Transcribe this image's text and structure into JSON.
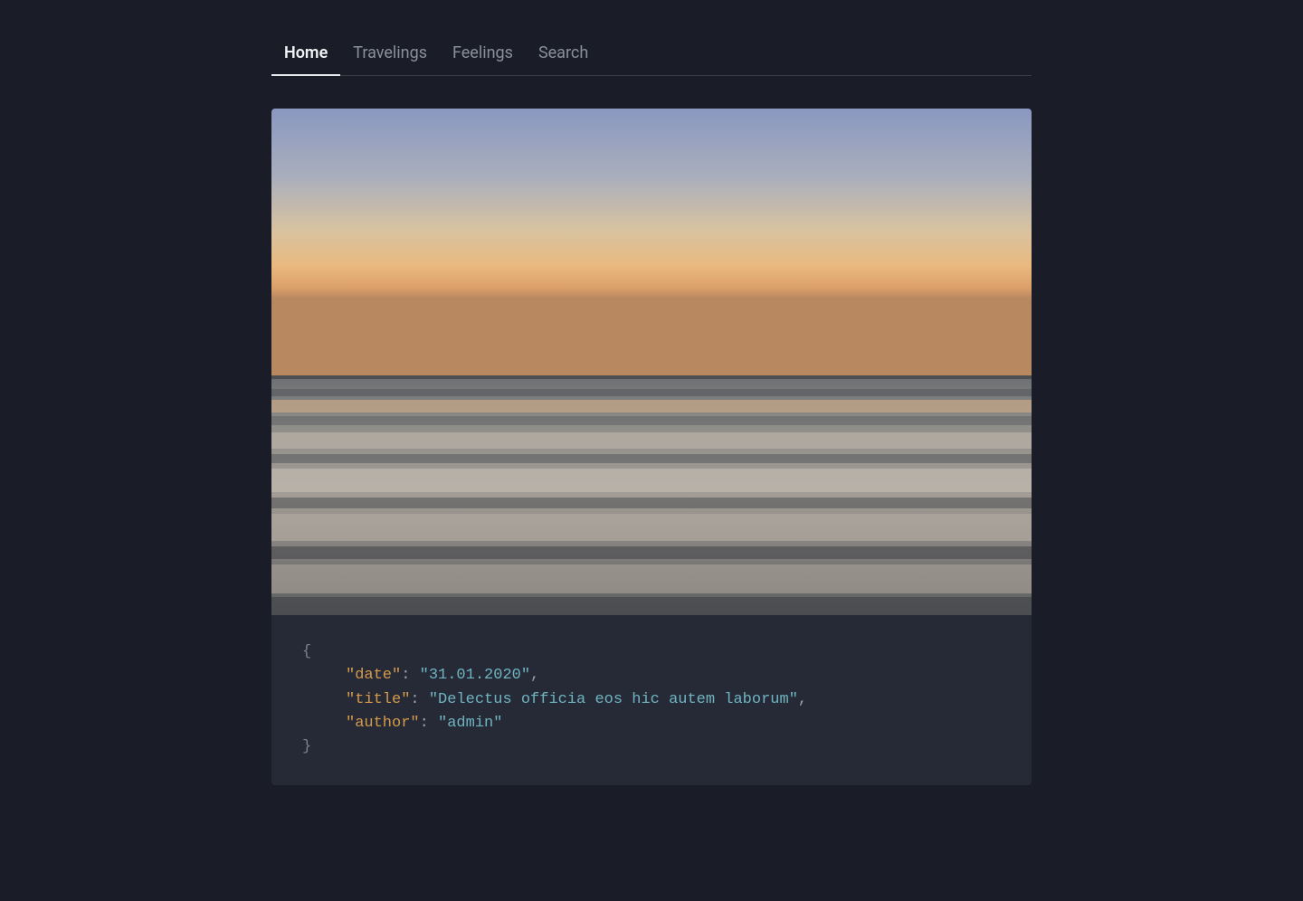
{
  "nav": {
    "tabs": [
      {
        "label": "Home",
        "active": true
      },
      {
        "label": "Travelings",
        "active": false
      },
      {
        "label": "Feelings",
        "active": false
      },
      {
        "label": "Search",
        "active": false
      }
    ]
  },
  "post": {
    "code": {
      "open_brace": "{",
      "close_brace": "}",
      "fields": [
        {
          "key": "\"date\"",
          "colon": ":",
          "value": "\"31.01.2020\"",
          "comma": ","
        },
        {
          "key": "\"title\"",
          "colon": ":",
          "value": "\"Delectus officia eos hic autem laborum\"",
          "comma": ","
        },
        {
          "key": "\"author\"",
          "colon": ":",
          "value": "\"admin\"",
          "comma": ""
        }
      ]
    }
  }
}
